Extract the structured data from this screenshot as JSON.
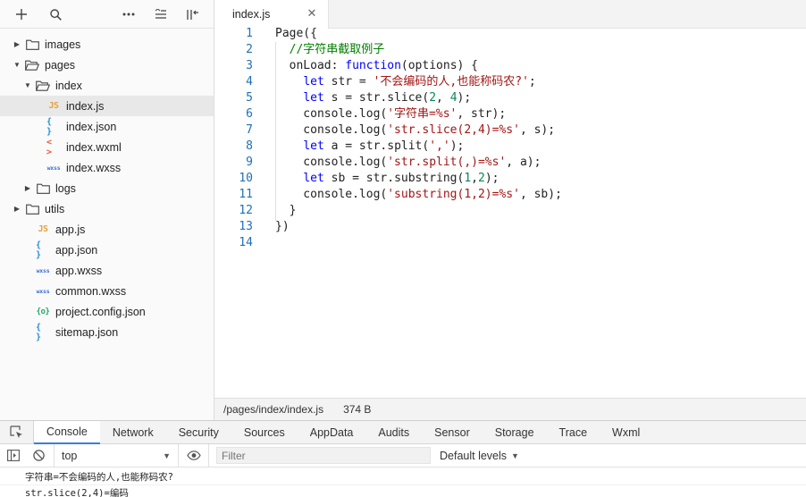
{
  "sidebar": {
    "tree": [
      {
        "label": "images",
        "type": "folder",
        "depth": 0,
        "expanded": false
      },
      {
        "label": "pages",
        "type": "folder",
        "depth": 0,
        "expanded": true
      },
      {
        "label": "index",
        "type": "folder",
        "depth": 1,
        "expanded": true
      },
      {
        "label": "index.js",
        "type": "js",
        "tag": "JS",
        "depth": 2,
        "selected": true
      },
      {
        "label": "index.json",
        "type": "json",
        "tag": "{ }",
        "depth": 2
      },
      {
        "label": "index.wxml",
        "type": "wxml",
        "tag": "< >",
        "depth": 2
      },
      {
        "label": "index.wxss",
        "type": "wxss",
        "tag": "wxss",
        "depth": 2
      },
      {
        "label": "logs",
        "type": "folder",
        "depth": 1,
        "expanded": false
      },
      {
        "label": "utils",
        "type": "folder",
        "depth": 0,
        "expanded": false
      },
      {
        "label": "app.js",
        "type": "js",
        "tag": "JS",
        "depth": 1
      },
      {
        "label": "app.json",
        "type": "json",
        "tag": "{ }",
        "depth": 1
      },
      {
        "label": "app.wxss",
        "type": "wxss",
        "tag": "wxss",
        "depth": 1
      },
      {
        "label": "common.wxss",
        "type": "wxss",
        "tag": "wxss",
        "depth": 1
      },
      {
        "label": "project.config.json",
        "type": "cfg",
        "tag": "{o}",
        "depth": 1
      },
      {
        "label": "sitemap.json",
        "type": "json",
        "tag": "{ }",
        "depth": 1
      }
    ]
  },
  "editor": {
    "tab_label": "index.js",
    "lines": [
      {
        "n": "1",
        "tokens": [
          [
            "plain",
            "Page({"
          ]
        ]
      },
      {
        "n": "2",
        "tokens": [
          [
            "plain",
            "  "
          ],
          [
            "cmt",
            "//字符串截取例子"
          ]
        ]
      },
      {
        "n": "3",
        "tokens": [
          [
            "plain",
            "  onLoad: "
          ],
          [
            "kw",
            "function"
          ],
          [
            "plain",
            "(options) {"
          ]
        ]
      },
      {
        "n": "4",
        "tokens": [
          [
            "plain",
            "    "
          ],
          [
            "kw",
            "let"
          ],
          [
            "plain",
            " str = "
          ],
          [
            "str",
            "'不会编码的人,也能称码农?'"
          ],
          [
            "plain",
            ";"
          ]
        ]
      },
      {
        "n": "5",
        "tokens": [
          [
            "plain",
            "    "
          ],
          [
            "kw",
            "let"
          ],
          [
            "plain",
            " s = str.slice("
          ],
          [
            "num",
            "2"
          ],
          [
            "plain",
            ", "
          ],
          [
            "num",
            "4"
          ],
          [
            "plain",
            ");"
          ]
        ]
      },
      {
        "n": "6",
        "tokens": [
          [
            "plain",
            "    console.log("
          ],
          [
            "str",
            "'字符串=%s'"
          ],
          [
            "plain",
            ", str);"
          ]
        ]
      },
      {
        "n": "7",
        "tokens": [
          [
            "plain",
            "    console.log("
          ],
          [
            "str",
            "'str.slice(2,4)=%s'"
          ],
          [
            "plain",
            ", s);"
          ]
        ]
      },
      {
        "n": "8",
        "tokens": [
          [
            "plain",
            "    "
          ],
          [
            "kw",
            "let"
          ],
          [
            "plain",
            " a = str.split("
          ],
          [
            "str",
            "','"
          ],
          [
            "plain",
            ");"
          ]
        ]
      },
      {
        "n": "9",
        "tokens": [
          [
            "plain",
            "    console.log("
          ],
          [
            "str",
            "'str.split(,)=%s'"
          ],
          [
            "plain",
            ", a);"
          ]
        ]
      },
      {
        "n": "10",
        "tokens": [
          [
            "plain",
            "    "
          ],
          [
            "kw",
            "let"
          ],
          [
            "plain",
            " sb = str.substring("
          ],
          [
            "num",
            "1"
          ],
          [
            "plain",
            ","
          ],
          [
            "num",
            "2"
          ],
          [
            "plain",
            ");"
          ]
        ]
      },
      {
        "n": "11",
        "tokens": [
          [
            "plain",
            "    console.log("
          ],
          [
            "str",
            "'substring(1,2)=%s'"
          ],
          [
            "plain",
            ", sb);"
          ]
        ]
      },
      {
        "n": "12",
        "tokens": [
          [
            "plain",
            "  }"
          ]
        ]
      },
      {
        "n": "13",
        "tokens": [
          [
            "plain",
            "})"
          ]
        ]
      },
      {
        "n": "14",
        "tokens": [
          [
            "plain",
            ""
          ]
        ]
      }
    ]
  },
  "status": {
    "path": "/pages/index/index.js",
    "size": "374 B"
  },
  "devtools": {
    "tabs": [
      "Console",
      "Network",
      "Security",
      "Sources",
      "AppData",
      "Audits",
      "Sensor",
      "Storage",
      "Trace",
      "Wxml"
    ],
    "active_tab": "Console",
    "context": "top",
    "filter_placeholder": "Filter",
    "levels": "Default levels",
    "logs": [
      "字符串=不会编码的人,也能称码农?",
      "str.slice(2,4)=编码"
    ]
  },
  "colors": {
    "accent": "#3b7ddd",
    "line_number": "#1e6fb8",
    "keyword": "#0000ff",
    "string": "#a31515",
    "comment": "#008000",
    "number": "#098658"
  }
}
